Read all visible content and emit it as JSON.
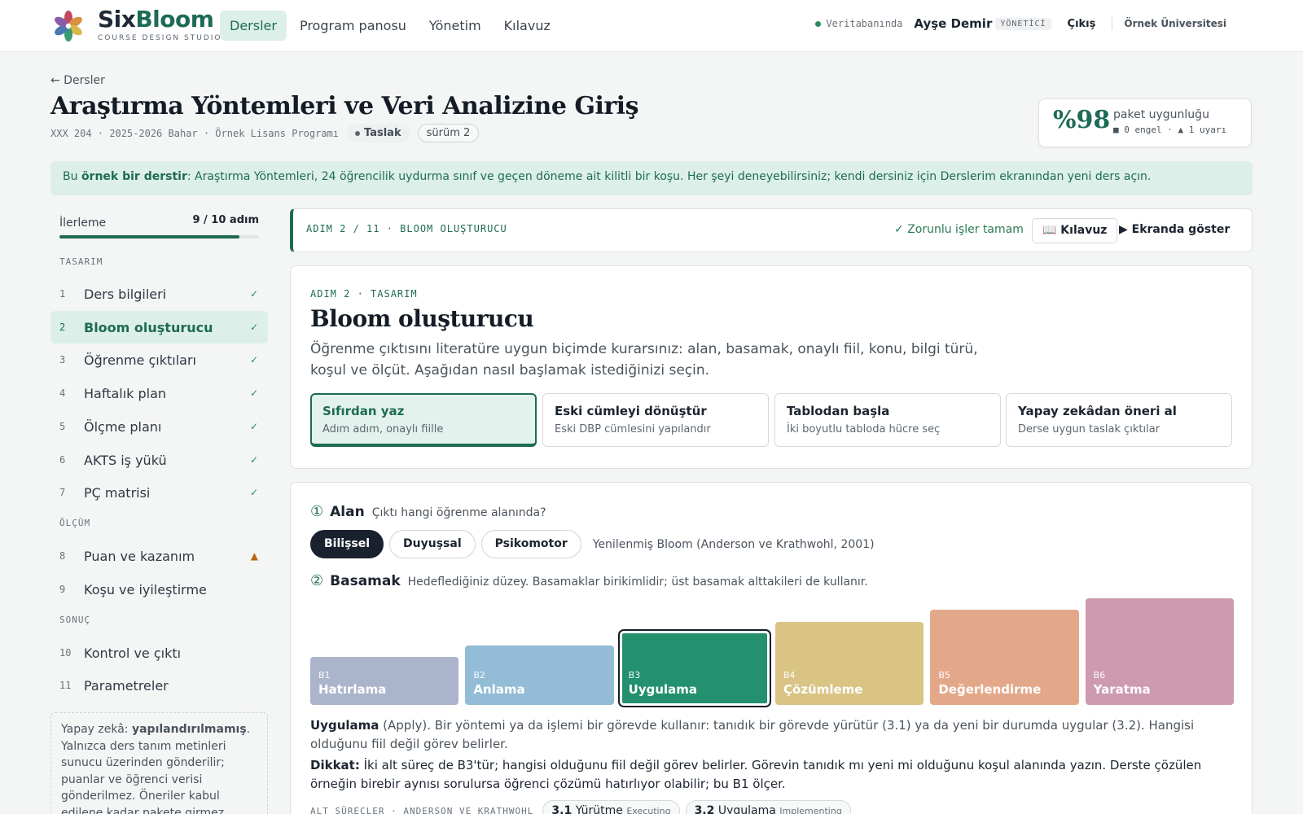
{
  "app": {
    "brand_a": "Six",
    "brand_b": "Bloom",
    "brand_sub": "COURSE DESIGN STUDIO"
  },
  "nav": [
    {
      "label": "Dersler",
      "active": true
    },
    {
      "label": "Program panosu"
    },
    {
      "label": "Yönetim"
    },
    {
      "label": "Kılavuz"
    }
  ],
  "topright": {
    "db": "Veritabanında",
    "user": "Ayşe Demir",
    "role": "YÖNETİCİ",
    "logout": "Çıkış",
    "university": "Örnek Üniversitesi"
  },
  "header": {
    "back": "← Dersler",
    "title": "Araştırma Yöntemleri ve Veri Analizine Giriş",
    "meta": "XXX 204 · 2025-2026 Bahar · Örnek Lisans Programı",
    "status": "Taslak",
    "version": "sürüm 2"
  },
  "score": {
    "value": "%98",
    "label": "paket uygunluğu",
    "status": "■ 0 engel · ▲ 1 uyarı"
  },
  "notice": {
    "pre": "Bu ",
    "bold": "örnek bir derstir",
    "post": ": Araştırma Yöntemleri, 24 öğrencilik uydurma sınıf ve geçen döneme ait kilitli bir koşu. Her şeyi deneyebilirsiniz; kendi dersiniz için Derslerim ekranından yeni ders açın."
  },
  "progress": {
    "label": "İlerleme",
    "value_text": "9 / 10 adım",
    "fraction": 0.9
  },
  "sidebar": {
    "sections": [
      "TASARIM",
      "ÖLÇÜM",
      "SONUÇ"
    ],
    "steps": [
      {
        "n": "1",
        "label": "Ders bilgileri",
        "mark": "✓"
      },
      {
        "n": "2",
        "label": "Bloom oluşturucu",
        "mark": "✓",
        "active": true
      },
      {
        "n": "3",
        "label": "Öğrenme çıktıları",
        "mark": "✓"
      },
      {
        "n": "4",
        "label": "Haftalık plan",
        "mark": "✓"
      },
      {
        "n": "5",
        "label": "Ölçme planı",
        "mark": "✓"
      },
      {
        "n": "6",
        "label": "AKTS iş yükü",
        "mark": "✓"
      },
      {
        "n": "7",
        "label": "PÇ matrisi",
        "mark": "✓"
      },
      {
        "n": "8",
        "label": "Puan ve kazanım",
        "mark": "▲"
      },
      {
        "n": "9",
        "label": "Koşu ve iyileştirme",
        "mark": ""
      },
      {
        "n": "10",
        "label": "Kontrol ve çıktı",
        "mark": ""
      },
      {
        "n": "11",
        "label": "Parametreler",
        "mark": ""
      }
    ],
    "ai_note_pre": "Yapay zekâ: ",
    "ai_note_bold": "yapılandırılmamış",
    "ai_note_post": ". Yalnızca ders tanım metinleri sunucu üzerinden gönderilir; puanlar ve öğrenci verisi gönderilmez. Öneriler kabul edilene kadar pakete girmez."
  },
  "stepbar": {
    "label": "ADIM 2 / 11 · BLOOM OLUŞTURUCU",
    "ok": "✓ Zorunlu işler tamam",
    "guide": "📖 Kılavuz",
    "show": "▶ Ekranda göster"
  },
  "intro": {
    "kicker": "ADIM 2 · TASARIM",
    "title": "Bloom oluşturucu",
    "desc": "Öğrenme çıktısını literatüre uygun biçimde kurarsınız: alan, basamak, onaylı fiil, konu, bilgi türü, koşul ve ölçüt. Aşağıdan nasıl başlamak istediğinizi seçin.",
    "options": [
      {
        "title": "Sıfırdan yaz",
        "sub": "Adım adım, onaylı fiille",
        "selected": true
      },
      {
        "title": "Eski cümleyi dönüştür",
        "sub": "Eski DBP cümlesini yapılandır"
      },
      {
        "title": "Tablodan başla",
        "sub": "İki boyutlu tabloda hücre seç"
      },
      {
        "title": "Yapay zekâdan öneri al",
        "sub": "Derse uygun taslak çıktılar"
      }
    ]
  },
  "builder": {
    "q1": {
      "num": "①",
      "title": "Alan",
      "desc": "Çıktı hangi öğrenme alanında?"
    },
    "domains": [
      {
        "label": "Bilişsel",
        "selected": true
      },
      {
        "label": "Duyuşsal"
      },
      {
        "label": "Psikomotor"
      }
    ],
    "domain_note": "Yenilenmiş Bloom (Anderson ve Krathwohl, 2001)",
    "q2": {
      "num": "②",
      "title": "Basamak",
      "desc": "Hedeflediğiniz düzey. Basamaklar birikimlidir; üst basamak alttakileri de kullanır."
    },
    "levels": [
      {
        "code": "B1",
        "name": "Hatırlama",
        "color": "#aab5cc",
        "level": 1
      },
      {
        "code": "B2",
        "name": "Anlama",
        "color": "#93bcd6",
        "level": 2
      },
      {
        "code": "B3",
        "name": "Uygulama",
        "color": "#23906e",
        "level": 3,
        "selected": true
      },
      {
        "code": "B4",
        "name": "Çözümleme",
        "color": "#dac484",
        "level": 4
      },
      {
        "code": "B5",
        "name": "Değerlendirme",
        "color": "#e3a88a",
        "level": 5
      },
      {
        "code": "B6",
        "name": "Yaratma",
        "color": "#cd9ab0",
        "level": 6
      }
    ],
    "desc_bold": "Uygulama",
    "desc_rest": " (Apply). Bir yöntemi ya da işlemi bir görevde kullanır: tanıdık bir görevde yürütür (3.1) ya da yeni bir durumda uygular (3.2). Hangisi olduğunu fiil değil görev belirler.",
    "warn_bold": "Dikkat:",
    "warn_rest": " İki alt süreç de B3'tür; hangisi olduğunu fiil değil görev belirler. Görevin tanıdık mı yeni mi olduğunu koşul alanında yazın. Derste çözülen örneğin birebir aynısı sorulursa öğrenci çözümü hatırlıyor olabilir; bu B1 ölçer.",
    "sub_label": "ALT SÜREÇLER · ANDERSON VE KRATHWOHL",
    "subprocesses": [
      {
        "code": "3.1",
        "name": "Yürütme",
        "en": "Executing"
      },
      {
        "code": "3.2",
        "name": "Uygulama",
        "en": "Implementing"
      }
    ]
  },
  "colors": {
    "accent": "#1e6b55",
    "accent_bg": "#dcefe8",
    "ink": "#141c26"
  }
}
